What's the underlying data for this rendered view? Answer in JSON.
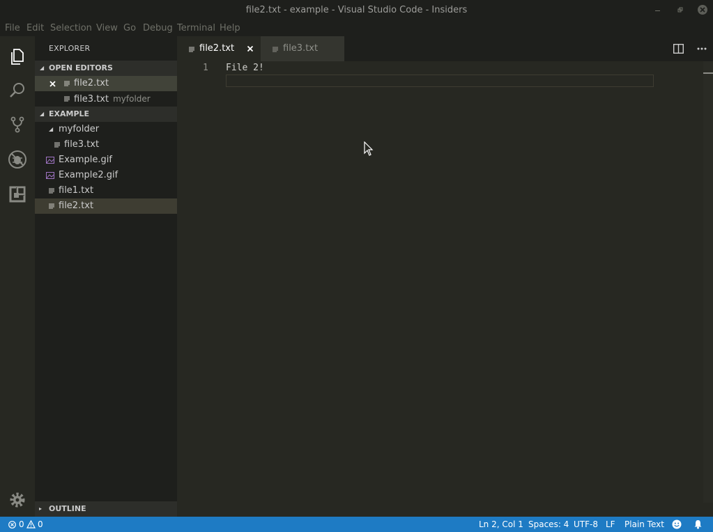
{
  "window": {
    "title": "file2.txt - example - Visual Studio Code - Insiders"
  },
  "menu": [
    "File",
    "Edit",
    "Selection",
    "View",
    "Go",
    "Debug",
    "Terminal",
    "Help"
  ],
  "activity_bar": {
    "items": [
      "explorer-icon",
      "search-icon",
      "source-control-icon",
      "debug-icon",
      "extensions-icon"
    ],
    "bottom": "gear-icon"
  },
  "sidebar": {
    "title": "EXPLORER",
    "open_editors": {
      "header": "OPEN EDITORS",
      "items": [
        {
          "name": "file2.txt",
          "description": ""
        },
        {
          "name": "file3.txt",
          "description": "myfolder"
        }
      ]
    },
    "workspace": {
      "header": "EXAMPLE",
      "items": [
        {
          "name": "myfolder"
        },
        {
          "name": "file3.txt"
        },
        {
          "name": "Example.gif"
        },
        {
          "name": "Example2.gif"
        },
        {
          "name": "file1.txt"
        },
        {
          "name": "file2.txt"
        }
      ]
    },
    "outline_header": "OUTLINE"
  },
  "tabs": [
    {
      "label": "file2.txt",
      "active": true
    },
    {
      "label": "file3.txt",
      "active": false
    }
  ],
  "editor": {
    "lines": [
      {
        "number": "1",
        "text": "File 2!"
      }
    ]
  },
  "status_bar": {
    "errors": "0",
    "warnings": "0",
    "position": "Ln 2, Col 1",
    "spaces": "Spaces: 4",
    "encoding": "UTF-8",
    "eol": "LF",
    "language": "Plain Text"
  },
  "colors": {
    "status_bar": "#1e7bc4",
    "sidebar": "#1e1f1c",
    "editor": "#272822",
    "gif_icon": "#a074c4"
  }
}
